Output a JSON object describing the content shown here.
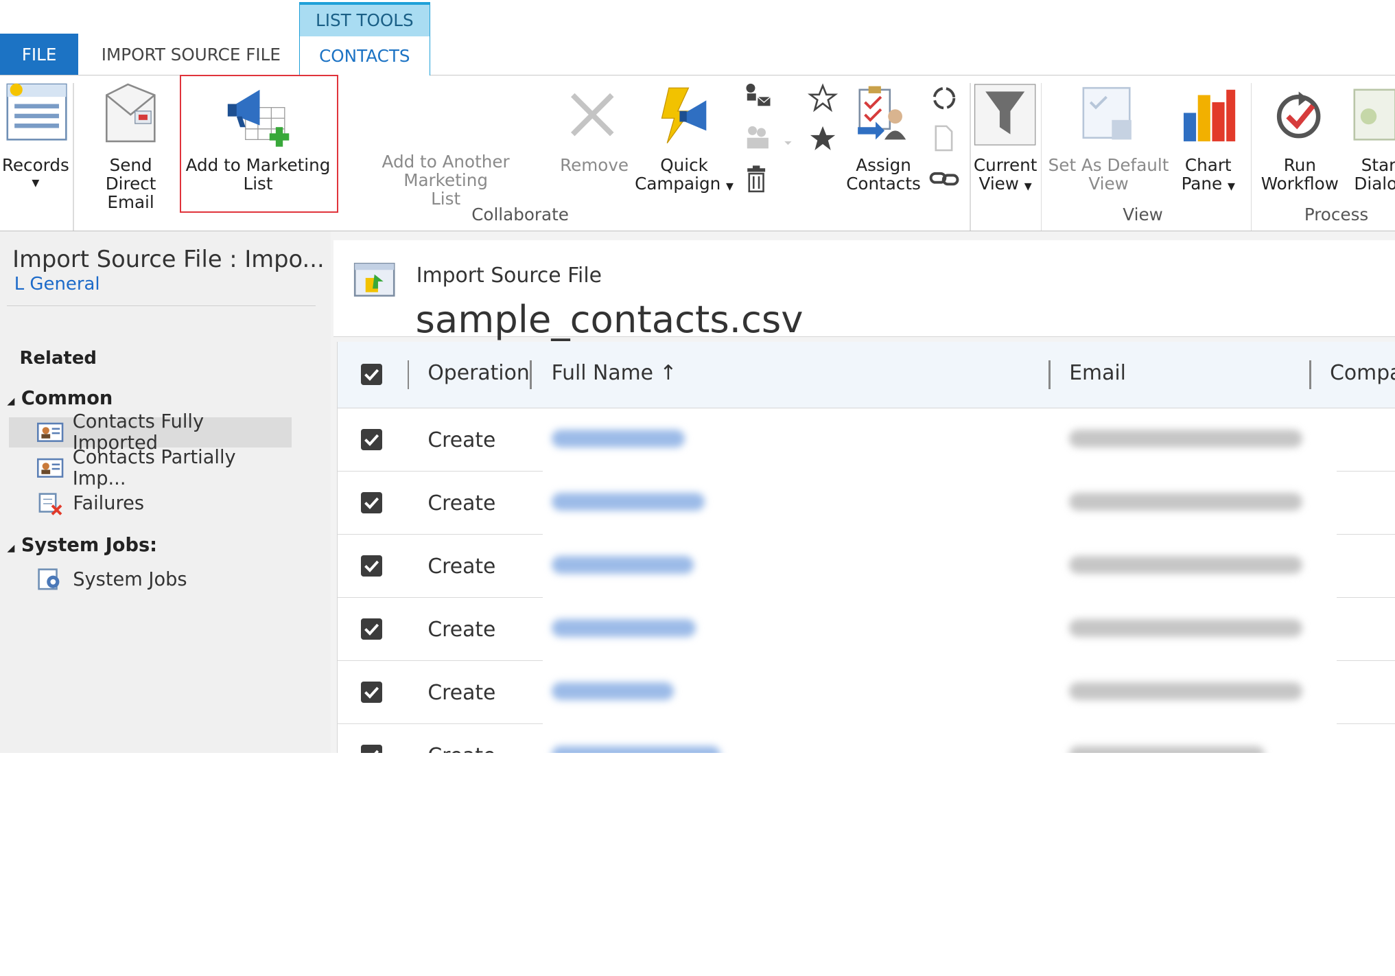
{
  "tabs": {
    "file": "FILE",
    "import_source_file": "IMPORT SOURCE FILE",
    "list_tools": "LIST TOOLS",
    "contacts": "CONTACTS"
  },
  "ribbon": {
    "records": "Records",
    "send_direct_email_1": "Send Direct",
    "send_direct_email_2": "Email",
    "add_marketing_1": "Add to Marketing",
    "add_marketing_2": "List",
    "add_another_1": "Add to Another Marketing",
    "add_another_2": "List",
    "remove": "Remove",
    "quick_campaign_1": "Quick",
    "quick_campaign_2": "Campaign",
    "assign_contacts_1": "Assign",
    "assign_contacts_2": "Contacts",
    "current_view_1": "Current",
    "current_view_2": "View",
    "set_default_1": "Set As Default",
    "set_default_2": "View",
    "chart_pane_1": "Chart",
    "chart_pane_2": "Pane",
    "run_workflow_1": "Run",
    "run_workflow_2": "Workflow",
    "start_dialog_1": "Start",
    "start_dialog_2": "Dialog",
    "group_collaborate": "Collaborate",
    "group_view": "View",
    "group_process": "Process"
  },
  "nav": {
    "title": "Import Source File : Impo...",
    "general": "General",
    "related": "Related",
    "common": "Common",
    "items": [
      {
        "label": "Contacts Fully Imported"
      },
      {
        "label": "Contacts Partially Imp..."
      },
      {
        "label": "Failures"
      }
    ],
    "system_jobs_section": "System Jobs:",
    "system_jobs": "System Jobs"
  },
  "record": {
    "entity_type": "Import Source File",
    "name": "sample_contacts.csv"
  },
  "grid": {
    "columns": [
      "Operation",
      "Full Name",
      "Email",
      "Company"
    ],
    "rows": [
      {
        "operation": "Create"
      },
      {
        "operation": "Create"
      },
      {
        "operation": "Create"
      },
      {
        "operation": "Create"
      },
      {
        "operation": "Create"
      },
      {
        "operation": "Create"
      }
    ]
  },
  "colors": {
    "accent": "#1c73c4",
    "list_tools": "#a9dcf2",
    "highlight_box": "#e0333b"
  }
}
